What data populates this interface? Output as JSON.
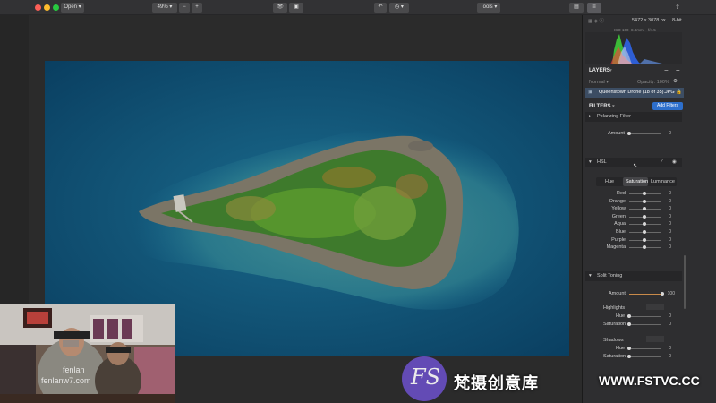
{
  "toolbar": {
    "open_label": "Open",
    "zoom_label": "49%",
    "zoom_out": "−",
    "zoom_in": "+",
    "tools_label": "Tools"
  },
  "panel": {
    "image_info": "5472 x 3078 px",
    "bit_depth": "8-bit",
    "exif": [
      "ISO 100",
      "8.8mm",
      "f/4.5"
    ],
    "layers_title": "LAYERS",
    "blend_mode": "Normal",
    "opacity": "Opacity: 100%",
    "layer_name": "Queenstown Drone (18 of 35).JPG",
    "filters_title": "FILTERS",
    "add_filters": "Add Filters",
    "polarizing": {
      "title": "Polarizing Filter",
      "amount_label": "Amount",
      "amount_value": "0"
    },
    "hsl": {
      "title": "HSL",
      "tabs": [
        "Hue",
        "Saturation",
        "Luminance"
      ],
      "active_tab": "Saturation",
      "rows": [
        {
          "label": "Red",
          "value": "0"
        },
        {
          "label": "Orange",
          "value": "0"
        },
        {
          "label": "Yellow",
          "value": "0"
        },
        {
          "label": "Green",
          "value": "0"
        },
        {
          "label": "Aqua",
          "value": "0"
        },
        {
          "label": "Blue",
          "value": "0"
        },
        {
          "label": "Purple",
          "value": "0"
        },
        {
          "label": "Magenta",
          "value": "0"
        }
      ]
    },
    "split": {
      "title": "Split Toning",
      "amount_label": "Amount",
      "amount_value": "100",
      "highlights_label": "Highlights",
      "hue_label": "Hue",
      "hue_value": "0",
      "sat_label": "Saturation",
      "sat_value": "0",
      "shadows_label": "Shadows",
      "sh_hue_label": "Hue",
      "sh_hue_value": "0",
      "sh_sat_label": "Saturation",
      "sh_sat_value": "0"
    }
  },
  "webcam": {
    "caption_1": "fenlan",
    "caption_2": "fenlanw7.com"
  },
  "watermark": {
    "logo": "FS",
    "text": "梵摄创意库",
    "url": "WWW.FSTVC.CC"
  },
  "colors": {
    "accent": "#2d6fcc",
    "water": "#0c4f72"
  }
}
